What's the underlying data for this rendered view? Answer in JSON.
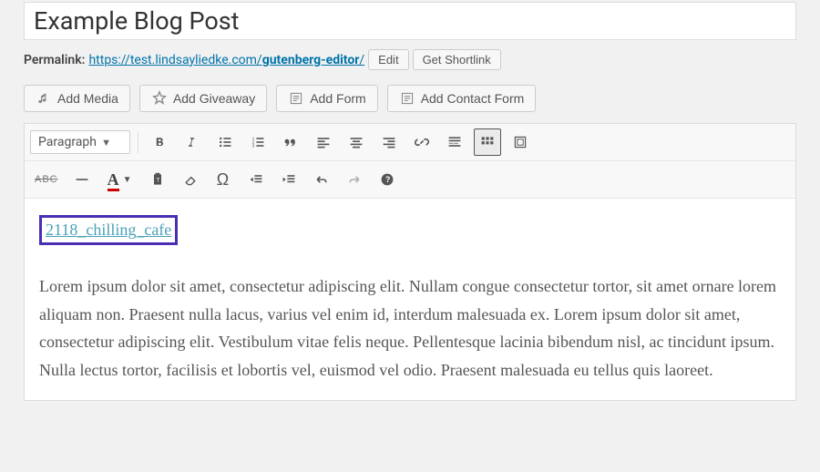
{
  "title": "Example Blog Post",
  "permalink": {
    "label": "Permalink:",
    "base": "https://test.lindsayliedke.com/",
    "slug": "gutenberg-editor",
    "trail": "/",
    "edit": "Edit",
    "shortlink": "Get Shortlink"
  },
  "media": {
    "addMedia": "Add Media",
    "addGiveaway": "Add Giveaway",
    "addForm": "Add Form",
    "addContactForm": "Add Contact Form"
  },
  "toolbar": {
    "format": "Paragraph"
  },
  "content": {
    "linkText": "2118_chilling_cafe",
    "para": "Lorem ipsum dolor sit amet, consectetur adipiscing elit. Nullam congue consectetur tortor, sit amet ornare lorem aliquam non. Praesent nulla lacus, varius vel enim id, interdum malesuada ex. Lorem ipsum dolor sit amet, consectetur adipiscing elit. Vestibulum vitae felis neque. Pellentesque lacinia bibendum nisl, ac tincidunt ipsum. Nulla lectus tortor, facilisis et lobortis vel, euismod vel odio. Praesent malesuada eu tellus quis laoreet."
  }
}
